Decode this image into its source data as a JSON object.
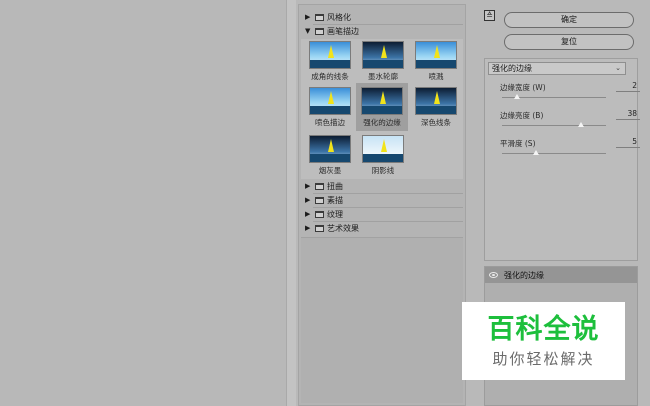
{
  "gallery": {
    "categories_top": [
      {
        "label": "风格化",
        "expanded": false
      },
      {
        "label": "画笔描边",
        "expanded": true
      }
    ],
    "thumbnails": [
      {
        "label": "成角的线条",
        "selected": false
      },
      {
        "label": "墨水轮廓",
        "selected": false
      },
      {
        "label": "喷溅",
        "selected": false
      },
      {
        "label": "喷色描边",
        "selected": false
      },
      {
        "label": "强化的边缘",
        "selected": true
      },
      {
        "label": "深色线条",
        "selected": false
      },
      {
        "label": "烟灰墨",
        "selected": false
      },
      {
        "label": "阴影线",
        "selected": false
      }
    ],
    "categories_bottom": [
      {
        "label": "扭曲",
        "expanded": false
      },
      {
        "label": "素描",
        "expanded": false
      },
      {
        "label": "纹理",
        "expanded": false
      },
      {
        "label": "艺术效果",
        "expanded": false
      }
    ]
  },
  "settings": {
    "collapse_glyph": "≙",
    "ok_label": "确定",
    "reset_label": "复位",
    "filter_select": "强化的边缘",
    "params": [
      {
        "name": "边缘宽度 (W)",
        "value": "2",
        "fraction": 0.14
      },
      {
        "name": "边缘亮度 (B)",
        "value": "38",
        "fraction": 0.76
      },
      {
        "name": "平滑度 (S)",
        "value": "5",
        "fraction": 0.33
      }
    ]
  },
  "layers": {
    "items": [
      {
        "name": "强化的边缘",
        "visible": true
      }
    ]
  },
  "watermark": {
    "title": "百科全说",
    "subtitle": "助你轻松解决"
  },
  "colors": {
    "panel_bg": "#b9b9b9",
    "selected_thumb": "#9f9f9f",
    "watermark_green": "#1dbf3c"
  }
}
